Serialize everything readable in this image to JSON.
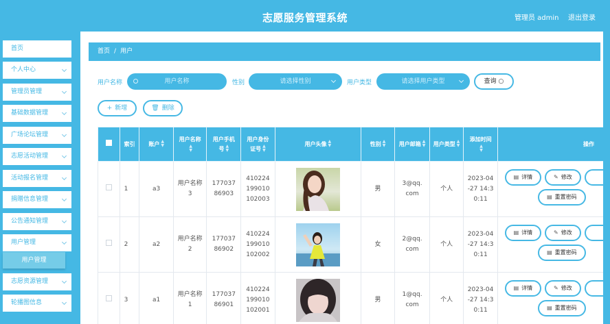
{
  "header": {
    "title": "志愿服务管理系统",
    "admin": "管理员 admin",
    "logout": "退出登录"
  },
  "sidebar": {
    "items": [
      "首页",
      "个人中心",
      "管理员管理",
      "基础数据管理",
      "广场论坛管理",
      "志愿活动管理",
      "活动报名管理",
      "捐赠信息管理",
      "公告通知管理",
      "用户管理",
      "志愿资源管理",
      "轮播图信息"
    ],
    "sub_item": "用户管理"
  },
  "breadcrumb": {
    "home": "首页",
    "sep": "/",
    "current": "用户"
  },
  "search": {
    "name_label": "用户名称",
    "name_placeholder": "用户名称",
    "gender_label": "性别",
    "gender_placeholder": "请选择性别",
    "type_label": "用户类型",
    "type_placeholder": "请选择用户类型",
    "query_label": "查询"
  },
  "actions": {
    "add_label": "新增",
    "delete_label": "删除"
  },
  "table": {
    "columns": [
      "索引",
      "账户",
      "用户名称",
      "用户手机号",
      "用户身份证号",
      "用户头像",
      "性别",
      "用户邮箱",
      "用户类型",
      "添加时间",
      "操作"
    ],
    "rows": [
      {
        "index": "1",
        "account": "a3",
        "name": "用户名称3",
        "phone": "17703786903",
        "idcard": "410224199010102003",
        "gender": "男",
        "email": "3@qq.com",
        "type": "个人",
        "time": "2023-04-27 14:30:11"
      },
      {
        "index": "2",
        "account": "a2",
        "name": "用户名称2",
        "phone": "17703786902",
        "idcard": "410224199010102002",
        "gender": "女",
        "email": "2@qq.com",
        "type": "个人",
        "time": "2023-04-27 14:30:11"
      },
      {
        "index": "3",
        "account": "a1",
        "name": "用户名称1",
        "phone": "17703786901",
        "idcard": "410224199010102001",
        "gender": "男",
        "email": "1@qq.com",
        "type": "个人",
        "time": "2023-04-27 14:30:11"
      }
    ],
    "op_detail": "详情",
    "op_edit": "修改",
    "op_reset": "重置密码"
  },
  "colors": {
    "accent": "#45b8e4",
    "sub_item_bg": "#75cce8"
  }
}
